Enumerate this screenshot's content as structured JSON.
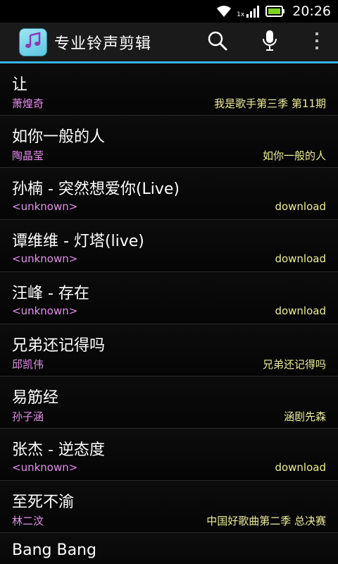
{
  "status_bar": {
    "network_label": "1x",
    "time": "20:26"
  },
  "action_bar": {
    "title": "专业铃声剪辑",
    "icons": [
      "music-note-icon",
      "search-icon",
      "microphone-icon",
      "overflow-menu-icon"
    ]
  },
  "colors": {
    "accent": "#33b5e5",
    "artist": "#e88ef0",
    "album": "#ecec9a"
  },
  "songs": [
    {
      "title": "让",
      "artist": "萧煌奇",
      "album": "我是歌手第三季 第11期"
    },
    {
      "title": "如你一般的人",
      "artist": "陶晶莹",
      "album": "如你一般的人"
    },
    {
      "title": "孙楠 - 突然想爱你(Live)",
      "artist": "<unknown>",
      "album": "download"
    },
    {
      "title": "谭维维 - 灯塔(live)",
      "artist": "<unknown>",
      "album": "download"
    },
    {
      "title": "汪峰 - 存在",
      "artist": "<unknown>",
      "album": "download"
    },
    {
      "title": "兄弟还记得吗",
      "artist": "邱凯伟",
      "album": "兄弟还记得吗"
    },
    {
      "title": "易筋经",
      "artist": "孙子涵",
      "album": "涵剧先森"
    },
    {
      "title": "张杰 - 逆态度",
      "artist": "<unknown>",
      "album": "download"
    },
    {
      "title": "至死不渝",
      "artist": "林二汶",
      "album": "中国好歌曲第二季 总决赛"
    },
    {
      "title": "Bang Bang",
      "artist": "",
      "album": ""
    }
  ]
}
